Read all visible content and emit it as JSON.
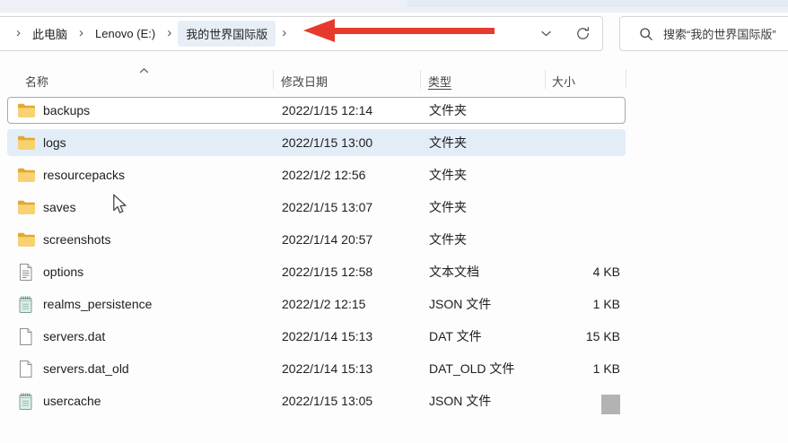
{
  "breadcrumb": {
    "separator": "›",
    "items": [
      "此电脑",
      "Lenovo (E:)",
      "我的世界国际版"
    ]
  },
  "address": {
    "dropdown_icon": "chevron-down-icon",
    "refresh_icon": "refresh-icon"
  },
  "search": {
    "placeholder": "搜索“我的世界国际版”"
  },
  "columns": {
    "name": "名称",
    "date": "修改日期",
    "type": "类型",
    "size": "大小"
  },
  "files": [
    {
      "name": "backups",
      "date": "2022/1/15 12:14",
      "type": "文件夹",
      "size": "",
      "icon": "folder-icon",
      "state": "selected",
      "size_redacted": false
    },
    {
      "name": "logs",
      "date": "2022/1/15 13:00",
      "type": "文件夹",
      "size": "",
      "icon": "folder-icon",
      "state": "hover",
      "size_redacted": false
    },
    {
      "name": "resourcepacks",
      "date": "2022/1/2 12:56",
      "type": "文件夹",
      "size": "",
      "icon": "folder-icon",
      "state": "",
      "size_redacted": false
    },
    {
      "name": "saves",
      "date": "2022/1/15 13:07",
      "type": "文件夹",
      "size": "",
      "icon": "folder-icon",
      "state": "",
      "size_redacted": false
    },
    {
      "name": "screenshots",
      "date": "2022/1/14 20:57",
      "type": "文件夹",
      "size": "",
      "icon": "folder-icon",
      "state": "",
      "size_redacted": false
    },
    {
      "name": "options",
      "date": "2022/1/15 12:58",
      "type": "文本文档",
      "size": "4 KB",
      "icon": "text-file-icon",
      "state": "",
      "size_redacted": false
    },
    {
      "name": "realms_persistence",
      "date": "2022/1/2 12:15",
      "type": "JSON 文件",
      "size": "1 KB",
      "icon": "json-file-icon",
      "state": "",
      "size_redacted": false
    },
    {
      "name": "servers.dat",
      "date": "2022/1/14 15:13",
      "type": "DAT 文件",
      "size": "15 KB",
      "icon": "dat-file-icon",
      "state": "",
      "size_redacted": false
    },
    {
      "name": "servers.dat_old",
      "date": "2022/1/14 15:13",
      "type": "DAT_OLD 文件",
      "size": "1 KB",
      "icon": "dat-file-icon",
      "state": "",
      "size_redacted": false
    },
    {
      "name": "usercache",
      "date": "2022/1/15 13:05",
      "type": "JSON 文件",
      "size": "",
      "icon": "json-file-icon",
      "state": "",
      "size_redacted": true
    }
  ],
  "colors": {
    "accent_arrow": "#e63b2c",
    "row_hover": "#e3edf8",
    "row_selected_border": "#a9a9a9",
    "breadcrumb_active_bg": "#e8eef6",
    "folder_front": "#f8d272",
    "folder_back": "#e3a82f",
    "redaction_gray": "#b3b3b3"
  }
}
